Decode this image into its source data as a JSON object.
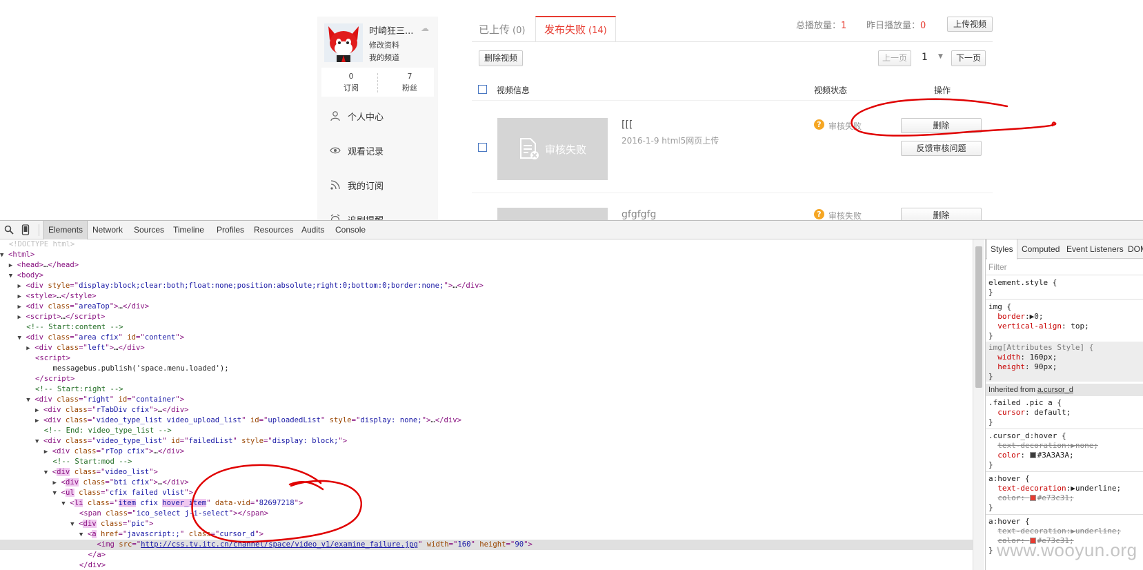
{
  "profile": {
    "username": "时崎狂三...",
    "edit_profile": "修改资料",
    "my_channel": "我的频道",
    "subscriptions_count": "0",
    "subscriptions_label": "订阅",
    "fans_count": "7",
    "fans_label": "粉丝"
  },
  "menu": {
    "items": [
      {
        "label": "个人中心",
        "icon": "user-icon"
      },
      {
        "label": "观看记录",
        "icon": "eye-icon"
      },
      {
        "label": "我的订阅",
        "icon": "rss-icon"
      },
      {
        "label": "追剧提醒",
        "icon": "alarm-icon"
      }
    ]
  },
  "tabs": {
    "uploaded_label": "已上传",
    "uploaded_count": "(0)",
    "failed_label": "发布失败",
    "failed_count": "(14)"
  },
  "header": {
    "total_plays_label": "总播放量：",
    "total_plays_value": "1",
    "yesterday_plays_label": "昨日播放量：",
    "yesterday_plays_value": "0",
    "upload_button": "上传视频"
  },
  "toolbar": {
    "delete_video_button": "删除视频",
    "prev_button": "上一页",
    "page_number": "1",
    "next_button": "下一页"
  },
  "table": {
    "col_info": "视频信息",
    "col_status": "视频状态",
    "col_op": "操作",
    "rows": [
      {
        "thumb_text": "审核失败",
        "title": "[[[",
        "date": "2016-1-9 html5网页上传",
        "status": "审核失败",
        "delete": "删除",
        "feedback": "反馈审核问题"
      },
      {
        "thumb_text": "",
        "title": "gfgfgfg",
        "date": "",
        "status": "审核失败",
        "delete": "删除",
        "feedback": ""
      }
    ]
  },
  "devtools": {
    "tabs": [
      "Elements",
      "Network",
      "Sources",
      "Timeline",
      "Profiles",
      "Resources",
      "Audits",
      "Console"
    ],
    "styles_tabs": [
      "Styles",
      "Computed",
      "Event Listeners",
      "DOM"
    ],
    "filter_placeholder": "Filter",
    "inherited_label": "Inherited from ",
    "inherited_link": "a.cursor_d",
    "img_src": "http://css.tv.itc.cn/channel/space/video_v1/examine_failure.jpg"
  },
  "colors": {
    "accent_red": "#e73c31",
    "annotation_red": "#e00000",
    "status_orange": "#f5a623"
  },
  "watermark": "www.wooyun.org"
}
